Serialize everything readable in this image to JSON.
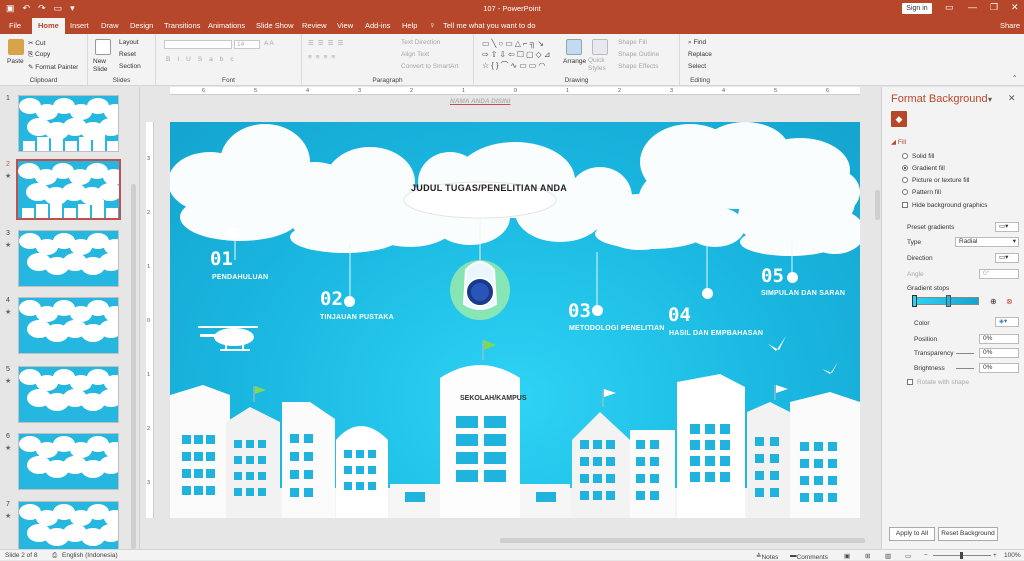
{
  "window": {
    "title": "107 - PowerPoint",
    "signin": "Sign in"
  },
  "tabs": [
    "File",
    "Home",
    "Insert",
    "Draw",
    "Design",
    "Transitions",
    "Animations",
    "Slide Show",
    "Review",
    "View",
    "Add-ins",
    "Help"
  ],
  "tellme": "Tell me what you want to do",
  "share": "Share",
  "ribbon": {
    "clipboard": {
      "label": "Clipboard",
      "paste": "Paste",
      "cut": "Cut",
      "copy": "Copy",
      "format_painter": "Format Painter"
    },
    "slides": {
      "label": "Slides",
      "new_slide": "New Slide",
      "layout": "Layout",
      "reset": "Reset",
      "section": "Section"
    },
    "font": {
      "label": "Font",
      "size": "14"
    },
    "paragraph": {
      "label": "Paragraph",
      "text_direction": "Text Direction",
      "align_text": "Align Text",
      "convert": "Convert to SmartArt"
    },
    "drawing": {
      "label": "Drawing",
      "arrange": "Arrange",
      "quick_styles": "Quick Styles",
      "shape_fill": "Shape Fill",
      "shape_outline": "Shape Outline",
      "shape_effects": "Shape Effects"
    },
    "editing": {
      "label": "Editing",
      "find": "Find",
      "replace": "Replace",
      "select": "Select"
    }
  },
  "thumbnails": [
    {
      "num": "1",
      "star": ""
    },
    {
      "num": "2",
      "star": "★"
    },
    {
      "num": "3",
      "star": "★"
    },
    {
      "num": "4",
      "star": "★"
    },
    {
      "num": "5",
      "star": "★"
    },
    {
      "num": "6",
      "star": "★"
    },
    {
      "num": "7",
      "star": "★"
    }
  ],
  "slide": {
    "header_text": "NAMA ANDA DISINI",
    "title": "JUDUL TUGAS/PENELITIAN ANDA",
    "items": [
      {
        "num": "01",
        "label": "PENDAHULUAN"
      },
      {
        "num": "02",
        "label": "TINJAUAN PUSTAKA"
      },
      {
        "num": "03",
        "label": "METODOLOGI PENELITIAN"
      },
      {
        "num": "04",
        "label": "HASIL DAN EMPBAHASAN"
      },
      {
        "num": "05",
        "label": "SIMPULAN DAN SARAN"
      }
    ],
    "school": "SEKOLAH/KAMPUS"
  },
  "pane": {
    "title": "Format Background",
    "fill": "Fill",
    "solid": "Solid fill",
    "gradient": "Gradient fill",
    "picture": "Picture or texture fill",
    "pattern": "Pattern fill",
    "hide": "Hide background graphics",
    "preset": "Preset gradients",
    "type_label": "Type",
    "type_value": "Radial",
    "direction": "Direction",
    "angle": "Angle",
    "angle_value": "0°",
    "stops": "Gradient stops",
    "color": "Color",
    "position": "Position",
    "position_value": "0%",
    "transparency": "Transparency",
    "transparency_value": "0%",
    "brightness": "Brightness",
    "brightness_value": "0%",
    "rotate": "Rotate with shape",
    "apply_all": "Apply to All",
    "reset": "Reset Background"
  },
  "status": {
    "slide": "Slide 2 of 8",
    "lang": "English (Indonesia)",
    "notes": "Notes",
    "comments": "Comments",
    "zoom": "100%"
  },
  "colors": {
    "accent": "#b7472a",
    "sky": "#1ab7e0",
    "window": "#1fb3dd"
  }
}
